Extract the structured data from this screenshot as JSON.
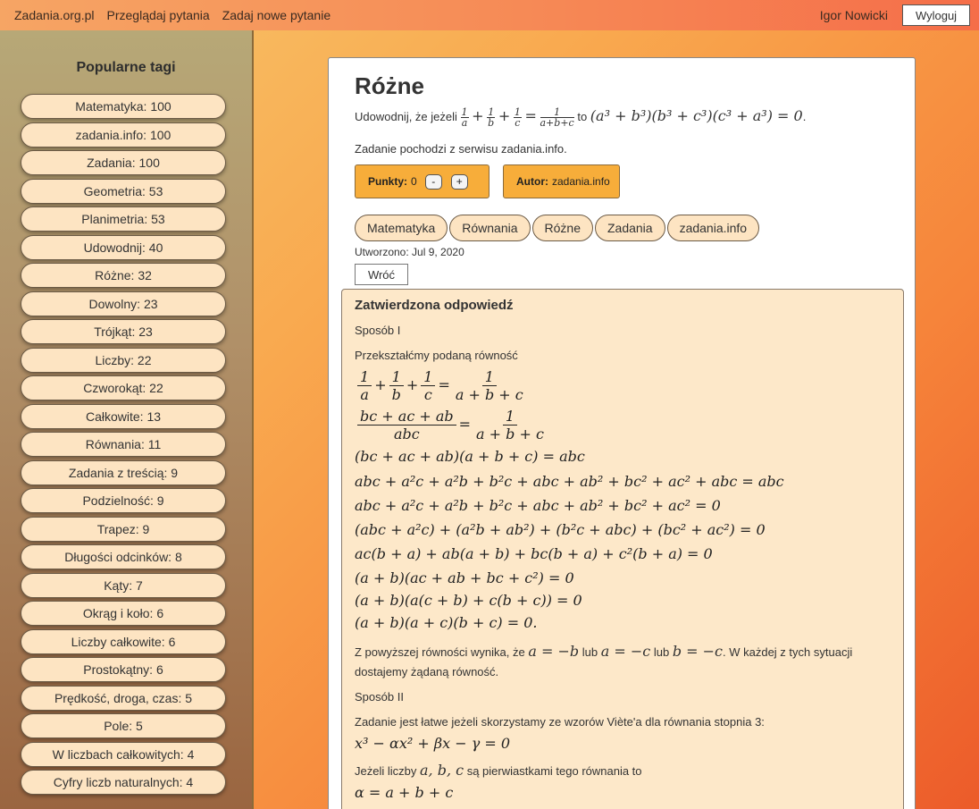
{
  "topbar": {
    "brand": "Zadania.org.pl",
    "browse": "Przeglądaj pytania",
    "ask": "Zadaj nowe pytanie",
    "user": "Igor Nowicki",
    "logout": "Wyloguj"
  },
  "sidebar": {
    "heading": "Popularne tagi",
    "tags": [
      "Matematyka: 100",
      "zadania.info: 100",
      "Zadania: 100",
      "Geometria: 53",
      "Planimetria: 53",
      "Udowodnij: 40",
      "Różne: 32",
      "Dowolny: 23",
      "Trójkąt: 23",
      "Liczby: 22",
      "Czworokąt: 22",
      "Całkowite: 13",
      "Równania: 11",
      "Zadania z treścią: 9",
      "Podzielność: 9",
      "Trapez: 9",
      "Długości odcinków: 8",
      "Kąty: 7",
      "Okrąg i koło: 6",
      "Liczby całkowite: 6",
      "Prostokątny: 6",
      "Prędkość, droga, czas: 5",
      "Pole: 5",
      "W liczbach całkowitych: 4",
      "Cyfry liczb naturalnych: 4"
    ]
  },
  "question": {
    "title": "Różne",
    "prompt_prefix": "Udowodnij, że jeżeli",
    "prompt_mid": "to",
    "source": "Zadanie pochodzi z serwisu zadania.info.",
    "points_label": "Punkty:",
    "points_value": "0",
    "minus": "-",
    "plus": "+",
    "author_label": "Autor:",
    "author_value": "zadania.info",
    "tags": [
      "Matematyka",
      "Równania",
      "Różne",
      "Zadania",
      "zadania.info"
    ],
    "created": "Utworzono: Jul 9, 2020",
    "back": "Wróć"
  },
  "answer": {
    "heading": "Zatwierdzona odpowiedź",
    "method1": "Sposób I",
    "transform": "Przekształćmy podaną równość",
    "lines": [
      "(bc + ac + ab)(a + b + c) = abc",
      "abc + a²c + a²b + b²c + abc + ab² + bc² + ac² + abc = abc",
      "abc + a²c + a²b + b²c + abc + ab² + bc² + ac² = 0",
      "(abc + a²c) + (a²b + ab²) + (b²c + abc) + (bc² + ac²) = 0",
      "ac(b + a) + ab(a + b) + bc(b + a) + c²(b + a) = 0",
      "(a + b)(ac + ab + bc + c²) = 0",
      "(a + b)(a(c + b) + c(b + c)) = 0",
      "(a + b)(a + c)(b + c) = 0."
    ],
    "conclusion_1": "Z powyższej równości wynika, że",
    "conclusion_eq1": "a = −b",
    "conclusion_or": "lub",
    "conclusion_eq2": "a = −c",
    "conclusion_eq3": "b = −c",
    "conclusion_2": ". W każdej z tych sytuacji dostajemy żądaną równość.",
    "method2": "Sposób II",
    "viete": "Zadanie jest łatwe jeżeli skorzystamy ze wzorów Viète'a dla równania stopnia 3:",
    "cubic": "x³ − αx² + βx − γ = 0",
    "roots_prefix": "Jeżeli liczby",
    "roots_vars": "a, b, c",
    "roots_suffix": "są pierwiastkami tego równania to",
    "alpha": "α = a + b + c"
  }
}
